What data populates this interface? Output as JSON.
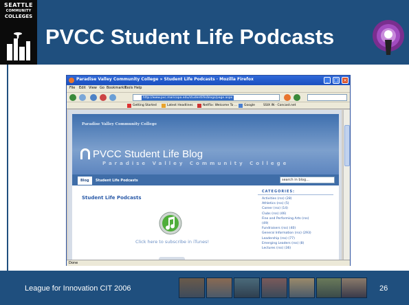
{
  "slide": {
    "title": "PVCC Student Life Podcasts",
    "logo": {
      "line1": "SEATTLE",
      "line2": "COMMUNITY",
      "line3": "COLLEGES"
    },
    "footer_text": "League for Innovation CIT 2006",
    "page_number": "26",
    "colors": {
      "header_bg": "#1f4f7e",
      "footer_bg": "#1f4f7e",
      "logo_bg": "#0b0b0b"
    }
  },
  "browser": {
    "window_title": "Paradise Valley Community College » Student Life Podcasts · Mozilla Firefox",
    "menu": [
      "File",
      "Edit",
      "View",
      "Go",
      "Bookmarks",
      "Tools",
      "Help"
    ],
    "url": "http://www.pvc.maricopa.edu/studentlife/blogs/page.aspx",
    "bookmarks": [
      "Getting Started",
      "Latest Headlines",
      "Netflix: Welcome To ...",
      "Google",
      "SSIX IN · Concast.net"
    ],
    "status": "Done"
  },
  "blog": {
    "college_label": "Paradise Valley Community College",
    "title": "PVCC Student Life Blog",
    "subtitle": "Paradise Valley Community College",
    "tabs": [
      "Blog",
      "Student Life Podcasts"
    ],
    "search_placeholder": "search in blog...",
    "main_heading": "Student Life Podcasts",
    "itunes_link": "Click here to subscribe in iTunes!",
    "categories_heading": "CATEGORIES:",
    "categories": [
      "Activities (rss) (28)",
      "Athletics (rss) (5)",
      "Career (rss) (14)",
      "Clubs (rss) (46)",
      "Fine and Performing Arts (rss)",
      "(49)",
      "Fundraisers (rss) (40)",
      "General Information (rss) (293)",
      "Leadership (rss) (77)",
      "  Emerging Leaders (rss) (8)",
      "Lectures (rss) (36)"
    ]
  }
}
